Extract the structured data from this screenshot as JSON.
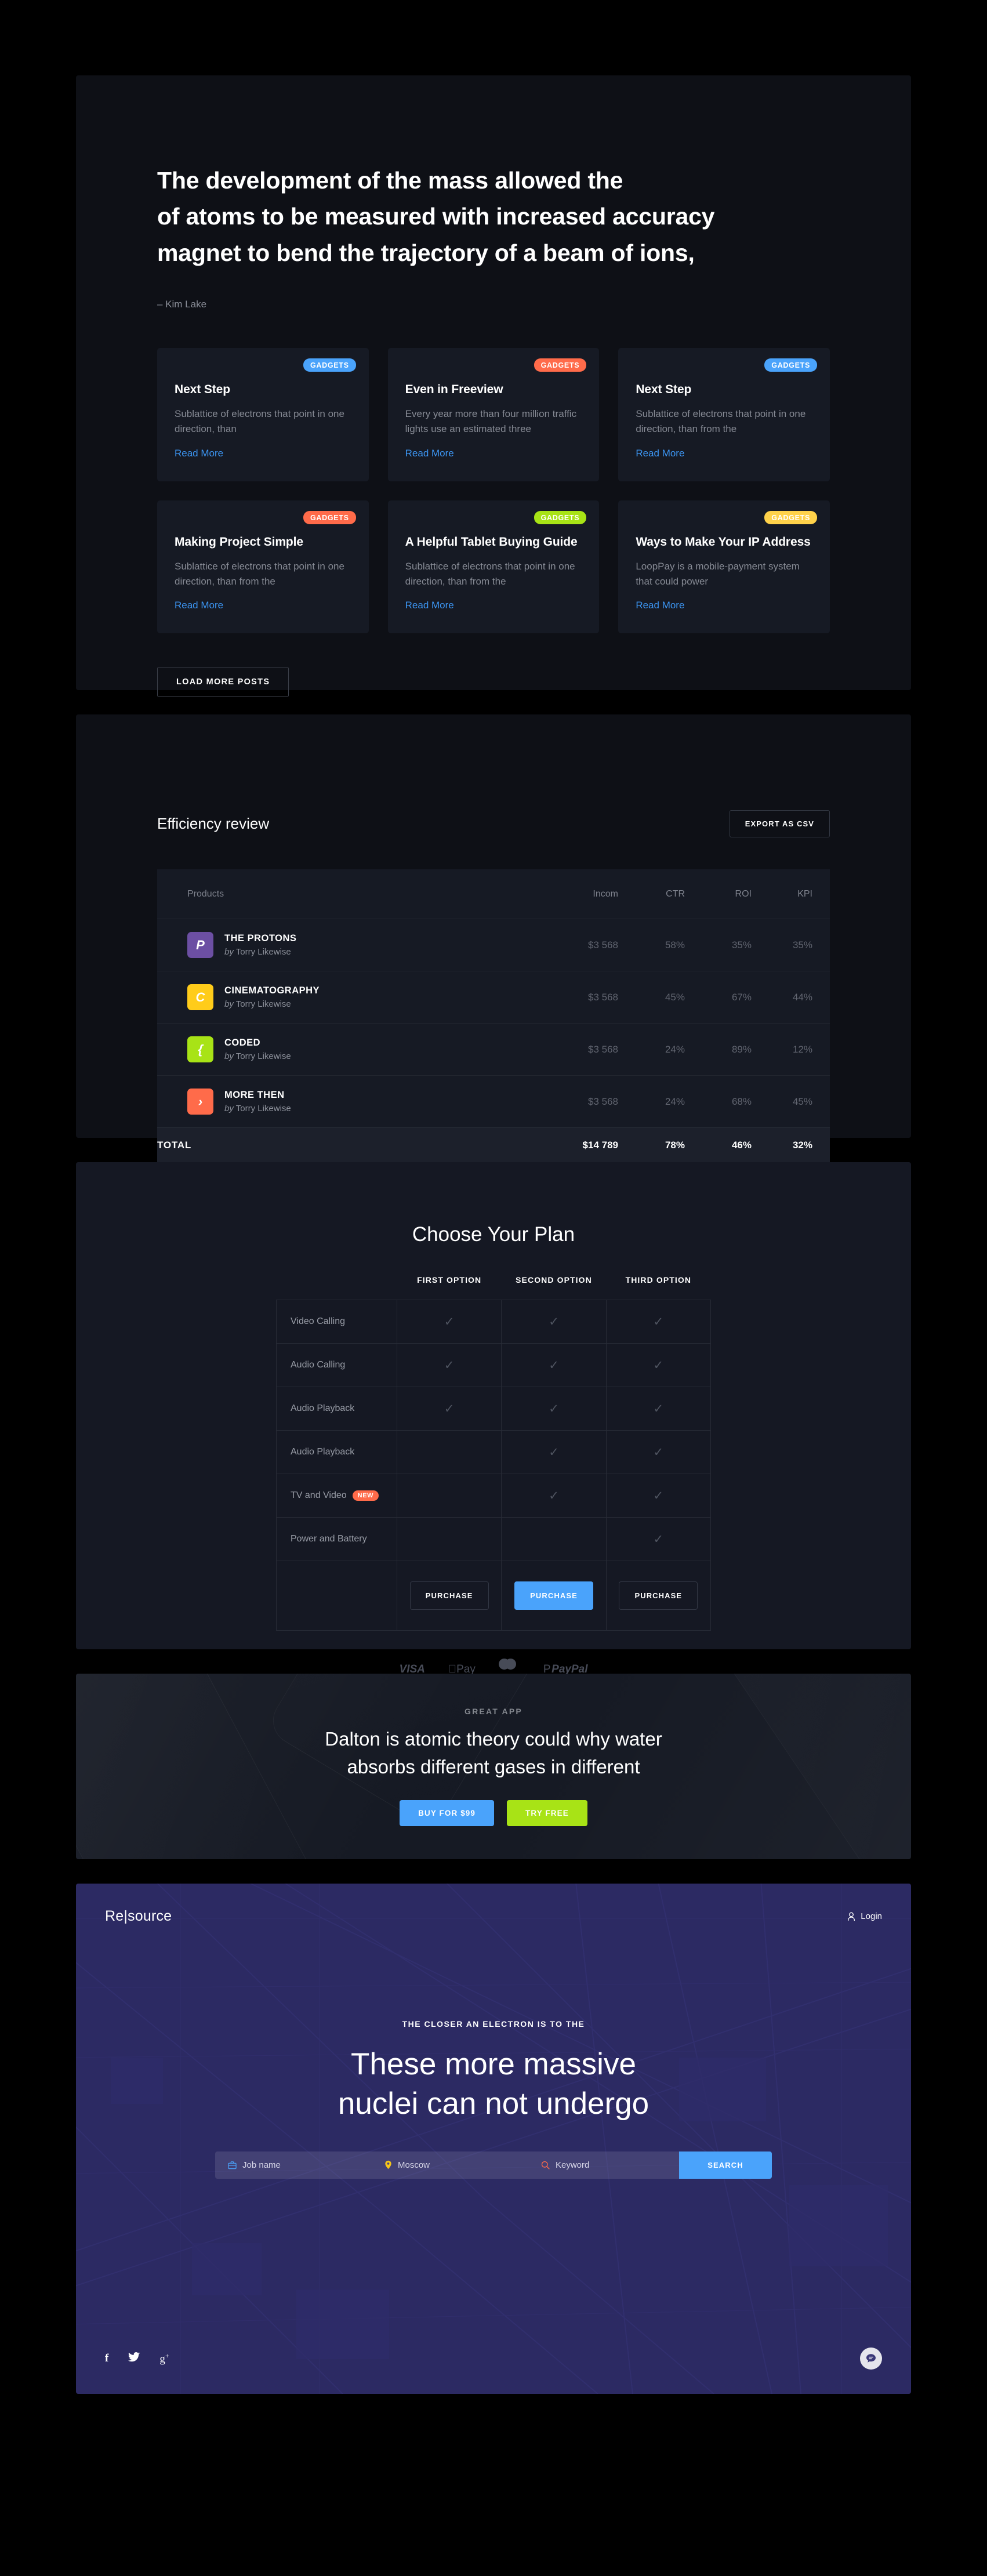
{
  "blog": {
    "quote": "The development of the mass allowed the\nof atoms to be measured with increased accuracy\nmagnet to bend the trajectory of a beam of ions,",
    "author": "– Kim Lake",
    "load_more_label": "LOAD MORE POSTS",
    "read_more_label": "Read More",
    "cards": [
      {
        "badge": "GADGETS",
        "badge_color": "#4aa3fb",
        "title": "Next Step",
        "desc": "Sublattice of electrons that point in one direction, than"
      },
      {
        "badge": "GADGETS",
        "badge_color": "#ff6b4a",
        "title": "Even in Freeview",
        "desc": "Every year more than four million traffic lights use an estimated three"
      },
      {
        "badge": "GADGETS",
        "badge_color": "#4aa3fb",
        "title": "Next Step",
        "desc": "Sublattice of electrons that point in one direction, than from the"
      },
      {
        "badge": "GADGETS",
        "badge_color": "#ff6b4a",
        "title": "Making Project Simple",
        "desc": "Sublattice of electrons that point in one direction, than from the"
      },
      {
        "badge": "GADGETS",
        "badge_color": "#a8e316",
        "title": "A Helpful Tablet Buying Guide",
        "desc": "Sublattice of electrons that point in one direction, than from the"
      },
      {
        "badge": "GADGETS",
        "badge_color": "#ffd24a",
        "title": "Ways to Make Your IP Address",
        "desc": "LoopPay is a mobile-payment system that could power"
      }
    ]
  },
  "efficiency": {
    "title": "Efficiency review",
    "export_label": "EXPORT AS CSV",
    "columns": [
      "Products",
      "Incom",
      "CTR",
      "ROI",
      "KPI"
    ],
    "rows": [
      {
        "logo": "P",
        "logo_color": "#6c4fa3",
        "name": "THE PROTONS",
        "by_prefix": "by",
        "by": "Torry Likewise",
        "incom": "$3 568",
        "ctr": "58%",
        "roi": "35%",
        "kpi": "35%"
      },
      {
        "logo": "C",
        "logo_color": "#ffcc1a",
        "name": "CINEMATOGRAPHY",
        "by_prefix": "by",
        "by": "Torry Likewise",
        "incom": "$3 568",
        "ctr": "45%",
        "roi": "67%",
        "kpi": "44%"
      },
      {
        "logo": "{",
        "logo_color": "#a8e316",
        "name": "CODED",
        "by_prefix": "by",
        "by": "Torry Likewise",
        "incom": "$3 568",
        "ctr": "24%",
        "roi": "89%",
        "kpi": "12%"
      },
      {
        "logo": "›",
        "logo_color": "#ff6b4a",
        "name": "MORE THEN",
        "by_prefix": "by",
        "by": "Torry Likewise",
        "incom": "$3 568",
        "ctr": "24%",
        "roi": "68%",
        "kpi": "45%"
      }
    ],
    "total": {
      "label": "TOTAL",
      "incom": "$14 789",
      "ctr": "78%",
      "roi": "46%",
      "kpi": "32%"
    }
  },
  "pricing": {
    "title": "Choose Your Plan",
    "plans": [
      "FIRST OPTION",
      "SECOND OPTION",
      "THIRD OPTION"
    ],
    "purchase_label": "PURCHASE",
    "features": [
      {
        "label": "Video Calling",
        "tag": "",
        "checks": [
          true,
          true,
          true
        ]
      },
      {
        "label": "Audio Calling",
        "tag": "",
        "checks": [
          true,
          true,
          true
        ]
      },
      {
        "label": "Audio Playback",
        "tag": "",
        "checks": [
          true,
          true,
          true
        ]
      },
      {
        "label": "Audio Playback",
        "tag": "",
        "checks": [
          false,
          true,
          true
        ]
      },
      {
        "label": "TV and Video",
        "tag": "NEW",
        "checks": [
          false,
          true,
          true
        ]
      },
      {
        "label": "Power and Battery",
        "tag": "",
        "checks": [
          false,
          false,
          true
        ]
      }
    ],
    "payments": [
      "VISA",
      "Pay",
      "mastercard",
      "PayPal"
    ]
  },
  "app": {
    "eyebrow": "GREAT APP",
    "headline_line1": "Dalton is atomic theory could why water",
    "headline_line2": "absorbs different gases in different",
    "buy_label": "BUY FOR $99",
    "try_label": "TRY FREE"
  },
  "hero": {
    "brand": "Re|source",
    "login_label": "Login",
    "eyebrow": "THE CLOSER AN ELECTRON IS TO THE",
    "headline_line1": "These more massive",
    "headline_line2": "nuclei can not undergo",
    "search": {
      "job_placeholder": "Job name",
      "location_value": "Moscow",
      "keyword_placeholder": "Keyword",
      "button_label": "SEARCH"
    },
    "socials": [
      "f",
      "twitter",
      "g+"
    ]
  },
  "colors": {
    "accent_blue": "#4aa3fb",
    "accent_green": "#a8e316",
    "accent_orange": "#ff6b4a",
    "accent_yellow": "#ffd24a",
    "hero_purple": "#2c2a63",
    "panel_dark": "#0e1016",
    "card_dark": "#161a24"
  }
}
